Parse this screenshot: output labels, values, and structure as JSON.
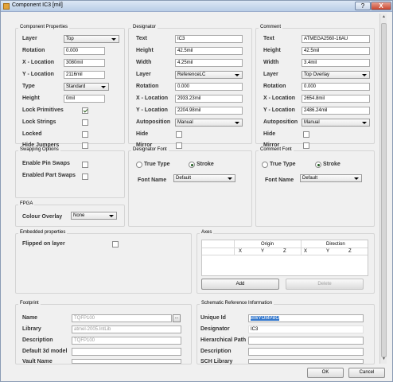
{
  "window": {
    "title": "Component IC3 [mil]",
    "help": "?",
    "close": "X"
  },
  "comp": {
    "title": "Component Properties",
    "labels": [
      "Layer",
      "Rotation",
      "X - Location",
      "Y - Location",
      "Type",
      "Height",
      "Lock Primitives",
      "Lock Strings",
      "Locked",
      "Hide Jumpers"
    ],
    "layer": "Top",
    "rotation": "0.000",
    "x": "3080mil",
    "y": "2116mil",
    "type": "Standard",
    "height": "0mil",
    "lock_primitives": true,
    "lock_strings": false,
    "locked": false,
    "hide_jumpers": false
  },
  "designator": {
    "title": "Designator",
    "labels": [
      "Text",
      "Height",
      "Width",
      "Layer",
      "Rotation",
      "X - Location",
      "Y - Location",
      "Autoposition",
      "Hide",
      "Mirror"
    ],
    "text": "IC3",
    "height": "42.5mil",
    "width": "4.25mil",
    "layer": "ReferenceLC",
    "rotation": "0.000",
    "x": "2933.23mil",
    "y": "2204.98mil",
    "autoposition": "Manual",
    "hide": false,
    "mirror": false
  },
  "comment": {
    "title": "Comment",
    "labels": [
      "Text",
      "Height",
      "Width",
      "Layer",
      "Rotation",
      "X - Location",
      "Y - Location",
      "Autoposition",
      "Hide",
      "Mirror"
    ],
    "text": "ATMEGA2560-16AU",
    "height": "42.5mil",
    "width": "3.4mil",
    "layer": "Top Overlay",
    "rotation": "0.000",
    "x": "2654.8mil",
    "y": "2486.24mil",
    "autoposition": "Manual",
    "hide": false,
    "mirror": false
  },
  "swapping": {
    "title": "Swapping Options",
    "pin_swaps": "Enable Pin Swaps",
    "part_swaps": "Enabled Part Swaps"
  },
  "designator_font": {
    "title": "Designator Font",
    "truetype": "True Type",
    "stroke": "Stroke",
    "font_name_label": "Font Name",
    "font_name": "Default"
  },
  "comment_font": {
    "title": "Comment Font",
    "truetype": "True Type",
    "stroke": "Stroke",
    "font_name_label": "Font Name",
    "font_name": "Default"
  },
  "fpga": {
    "title": "FPGA",
    "overlay_label": "Colour Overlay",
    "overlay": "None"
  },
  "embedded": {
    "title": "Embedded properties",
    "flipped_label": "Flipped on layer"
  },
  "axes": {
    "title": "Axes",
    "origin": "Origin",
    "direction": "Direction",
    "cols": [
      "X",
      "Y",
      "Z",
      "X",
      "Y",
      "Z"
    ],
    "add": "Add",
    "delete": "Delete"
  },
  "footprint": {
    "title": "Footprint",
    "labels": [
      "Name",
      "Library",
      "Description",
      "Default 3d model",
      "Vault Name"
    ],
    "name": "TQFP100",
    "library": "atmel-2005.IntLib",
    "description": "TQFP100",
    "model": "",
    "vault": "",
    "browse": "..."
  },
  "schematic": {
    "title": "Schematic Reference Information",
    "labels": [
      "Unique Id",
      "Designator",
      "Hierarchical Path",
      "Description",
      "SCH Library"
    ],
    "unique_id": "BWYOMPBO",
    "designator": "IC3",
    "path": "",
    "description": "",
    "library": ""
  },
  "buttons": {
    "ok": "OK",
    "cancel": "Cancel"
  },
  "colors": {
    "titlebar": "#c6d6ec",
    "selection": "#3377cc",
    "close": "#c8442c"
  }
}
